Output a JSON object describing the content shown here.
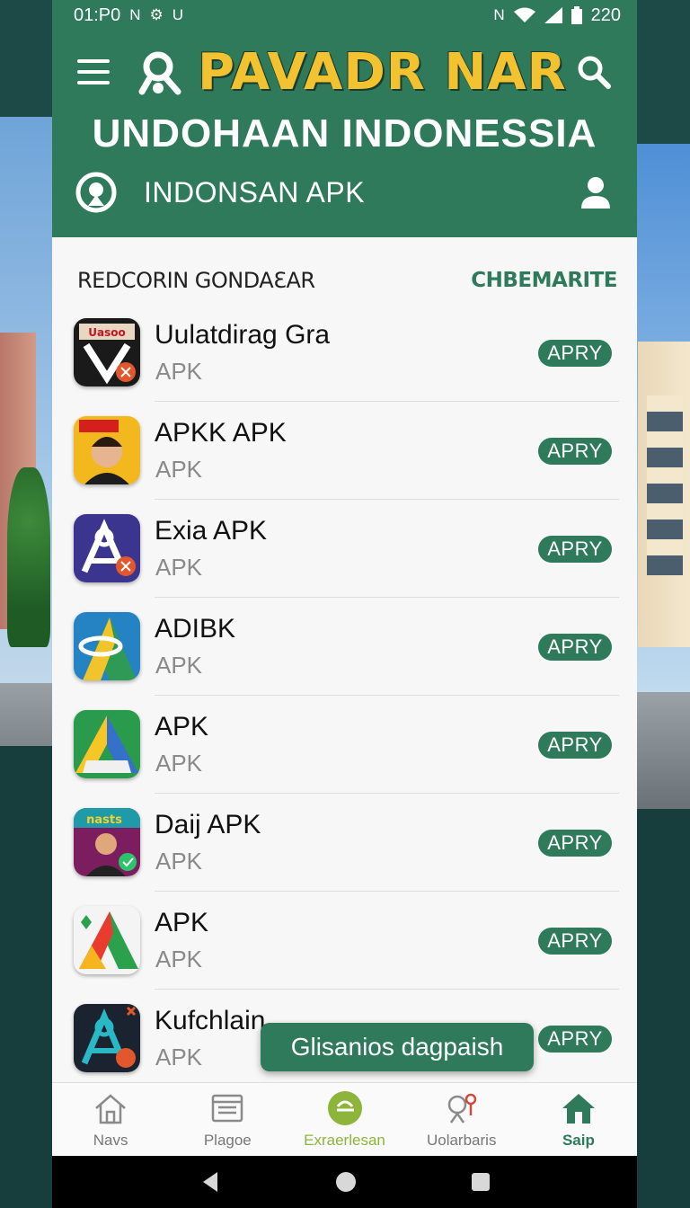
{
  "status_bar": {
    "time": "01:P0",
    "left_icons": [
      "N",
      "⚙",
      "U"
    ],
    "battery": "220"
  },
  "header": {
    "brand": "PAVADR NAR",
    "subtitle": "UNDOHAAN INDONESSIA",
    "tab_label": "INDONSAN APK"
  },
  "section": {
    "title": "REDCORIN GONDAƐAR",
    "link": "CHBEMARITE"
  },
  "apps": [
    {
      "name": "Uulatdirag Gra",
      "sub": "APK",
      "button": "APRY"
    },
    {
      "name": "APKK APK",
      "sub": "APK",
      "button": "APRY"
    },
    {
      "name": "Exia APK",
      "sub": "APK",
      "button": "APRY"
    },
    {
      "name": "ADIBK",
      "sub": "APK",
      "button": "APRY"
    },
    {
      "name": "APK",
      "sub": "APK",
      "button": "APRY"
    },
    {
      "name": "Daij APK",
      "sub": "APK",
      "button": "APRY"
    },
    {
      "name": "APK",
      "sub": "APK",
      "button": "APRY"
    },
    {
      "name": "Kufchlain",
      "sub": "APK",
      "button": "APRY"
    }
  ],
  "app_icon_texts": {
    "a1": "Uasoo",
    "a6": "nasts"
  },
  "toast": "Glisanios dagpaish",
  "bottom_nav": [
    {
      "label": "Navs",
      "icon": "home-icon"
    },
    {
      "label": "Plagoe",
      "icon": "news-icon"
    },
    {
      "label": "Exraerlesan",
      "icon": "explore-icon"
    },
    {
      "label": "Uolarbaris",
      "icon": "search-location-icon"
    },
    {
      "label": "Saip",
      "icon": "home-filled-icon"
    }
  ],
  "colors": {
    "primary": "#2e7a5b",
    "brand_yellow": "#f2c230",
    "accent_lime": "#8db53b"
  }
}
